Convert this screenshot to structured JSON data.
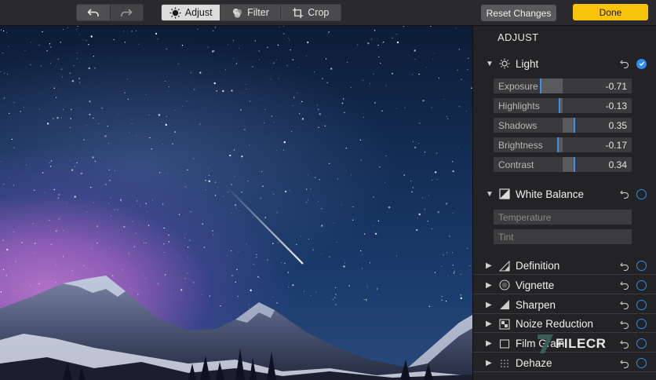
{
  "toolbar": {
    "undo_icon": "undo-icon",
    "redo_icon": "redo-icon",
    "tabs": [
      {
        "label": "Adjust",
        "icon": "adjust-icon",
        "active": true
      },
      {
        "label": "Filter",
        "icon": "filter-icon",
        "active": false
      },
      {
        "label": "Crop",
        "icon": "crop-icon",
        "active": false
      }
    ],
    "reset_label": "Reset Changes",
    "done_label": "Done"
  },
  "panel": {
    "title": "ADJUST",
    "light": {
      "label": "Light",
      "enabled": true,
      "sliders": [
        {
          "label": "Exposure",
          "value": "-0.71",
          "level": -0.71
        },
        {
          "label": "Highlights",
          "value": "-0.13",
          "level": -0.13
        },
        {
          "label": "Shadows",
          "value": "0.35",
          "level": 0.35
        },
        {
          "label": "Brightness",
          "value": "-0.17",
          "level": -0.17
        },
        {
          "label": "Contrast",
          "value": "0.34",
          "level": 0.34
        }
      ]
    },
    "white_balance": {
      "label": "White Balance",
      "enabled": false,
      "sliders": [
        {
          "label": "Temperature"
        },
        {
          "label": "Tint"
        }
      ]
    },
    "sections": [
      {
        "label": "Definition",
        "icon": "definition-icon"
      },
      {
        "label": "Vignette",
        "icon": "vignette-icon"
      },
      {
        "label": "Sharpen",
        "icon": "sharpen-icon"
      },
      {
        "label": "Noize Reduction",
        "icon": "noise-reduction-icon"
      },
      {
        "label": "Film Grain",
        "icon": "film-grain-icon"
      },
      {
        "label": "Dehaze",
        "icon": "dehaze-icon"
      }
    ]
  },
  "watermark": "FILECR",
  "colors": {
    "accent": "#2e8cf0",
    "done": "#f8c30a"
  }
}
